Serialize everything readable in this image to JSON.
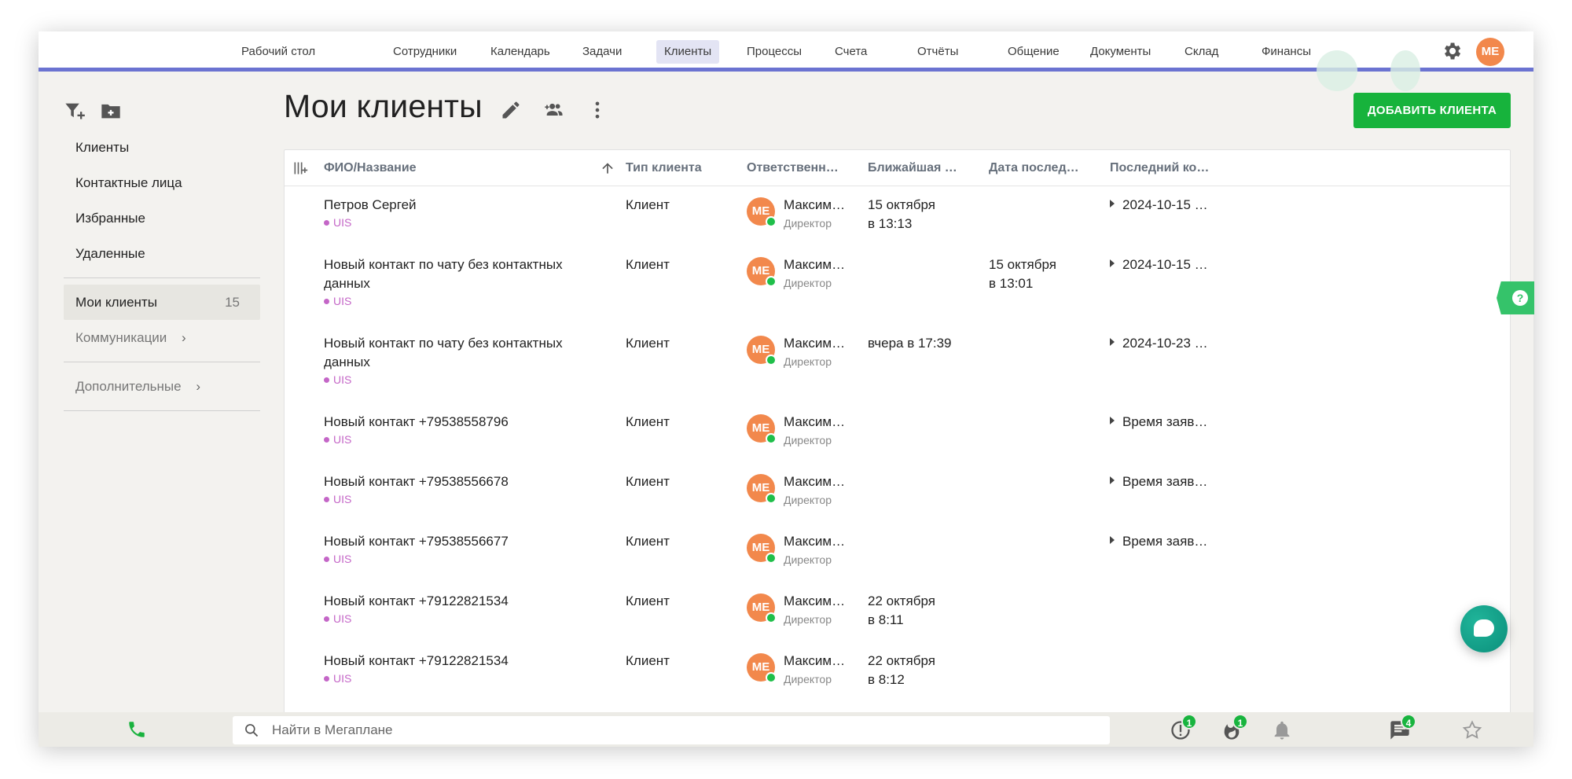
{
  "topnav": [
    "Рабочий стол",
    "Сотрудники",
    "Календарь",
    "Задачи",
    "Клиенты",
    "Процессы",
    "Счета",
    "Отчёты",
    "Общение",
    "Документы",
    "Склад",
    "Финансы"
  ],
  "user_initials": "ME",
  "sidebar": {
    "items": [
      "Клиенты",
      "Контактные лица",
      "Избранные",
      "Удаленные"
    ],
    "selected": {
      "label": "Мои клиенты",
      "count": "15"
    },
    "communications": "Коммуникации",
    "additional": "Дополнительные"
  },
  "page": {
    "title": "Мои клиенты",
    "add_button": "ДОБАВИТЬ КЛИЕНТА"
  },
  "table": {
    "headers": [
      "ФИО/Название",
      "Тип клиента",
      "Ответственн…",
      "Ближайшая …",
      "Дата послед…",
      "Последний ко…"
    ],
    "rows": [
      {
        "name": "Петров Сергей",
        "tag": "UIS",
        "type": "Клиент",
        "resp": "Максим…",
        "role": "Директор",
        "near": "15 октября\nв 13:13",
        "lastd": "",
        "lastc": "2024-10-15 …"
      },
      {
        "name": "Новый контакт по чату без контактных данных",
        "tag": "UIS",
        "type": "Клиент",
        "resp": "Максим…",
        "role": "Директор",
        "near": "",
        "lastd": "15 октября\nв 13:01",
        "lastc": "2024-10-15 …"
      },
      {
        "name": "Новый контакт по чату без контактных данных",
        "tag": "UIS",
        "type": "Клиент",
        "resp": "Максим…",
        "role": "Директор",
        "near": "вчера в 17:39",
        "lastd": "",
        "lastc": "2024-10-23 …"
      },
      {
        "name": "Новый контакт +79538558796",
        "tag": "UIS",
        "type": "Клиент",
        "resp": "Максим…",
        "role": "Директор",
        "near": "",
        "lastd": "",
        "lastc": "Время заяв…"
      },
      {
        "name": "Новый контакт +79538556678",
        "tag": "UIS",
        "type": "Клиент",
        "resp": "Максим…",
        "role": "Директор",
        "near": "",
        "lastd": "",
        "lastc": "Время заяв…"
      },
      {
        "name": "Новый контакт +79538556677",
        "tag": "UIS",
        "type": "Клиент",
        "resp": "Максим…",
        "role": "Директор",
        "near": "",
        "lastd": "",
        "lastc": "Время заяв…"
      },
      {
        "name": "Новый контакт +79122821534",
        "tag": "UIS",
        "type": "Клиент",
        "resp": "Максим…",
        "role": "Директор",
        "near": "22 октября\nв 8:11",
        "lastd": "",
        "lastc": ""
      },
      {
        "name": "Новый контакт +79122821534",
        "tag": "UIS",
        "type": "Клиент",
        "resp": "Максим…",
        "role": "Директор",
        "near": "22 октября\nв 8:12",
        "lastd": "",
        "lastc": ""
      }
    ]
  },
  "bottom": {
    "search_placeholder": "Найти в Мегаплане",
    "badges": {
      "alerts": "1",
      "hot": "1",
      "messages": "4"
    }
  },
  "colors": {
    "accent": "#6b73d1",
    "primary_button": "#17b33c",
    "avatar": "#f2884c",
    "tag": "#c466c7"
  },
  "icons": {
    "filter": "filter-add-icon",
    "folder": "folder-add-icon",
    "edit": "pencil-icon",
    "people": "add-people-icon",
    "more": "more-vertical-icon",
    "settings": "gear-icon",
    "phone": "phone-icon",
    "search": "search-icon",
    "star": "star-icon",
    "bell": "bell-icon",
    "chat": "chat-icon",
    "fire": "fire-icon",
    "alert": "alert-icon",
    "help": "help-icon"
  }
}
